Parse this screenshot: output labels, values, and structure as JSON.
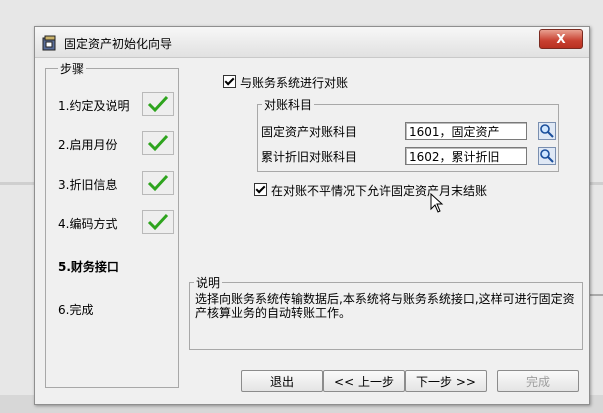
{
  "window": {
    "title": "固定资产初始化向导",
    "close_label": "X"
  },
  "steps": {
    "title": "步骤",
    "items": [
      {
        "label": "1.约定及说明",
        "done": true
      },
      {
        "label": "2.启用月份",
        "done": true
      },
      {
        "label": "3.折旧信息",
        "done": true
      },
      {
        "label": "4.编码方式",
        "done": true
      },
      {
        "label": "5.财务接口",
        "done": false,
        "current": true
      },
      {
        "label": "6.完成",
        "done": false
      }
    ]
  },
  "reconcile": {
    "checkbox_label": "与账务系统进行对账",
    "checked": true,
    "group_title": "对账科目",
    "asset_account_label": "固定资产对账科目",
    "asset_account_value": "1601，固定资产",
    "depr_account_label": "累计折旧对账科目",
    "depr_account_value": "1602，累计折旧",
    "allow_close_label": "在对账不平情况下允许固定资产月末结账",
    "allow_close_checked": true
  },
  "description": {
    "title": "说明",
    "text": "选择向账务系统传输数据后,本系统将与账务系统接口,这样可进行固定资产核算业务的自动转账工作。"
  },
  "buttons": {
    "exit": "退出",
    "prev": "<< 上一步",
    "next": "下一步 >>",
    "finish": "完成"
  },
  "colors": {
    "check": "#2ea41e",
    "close": "#c84030"
  }
}
